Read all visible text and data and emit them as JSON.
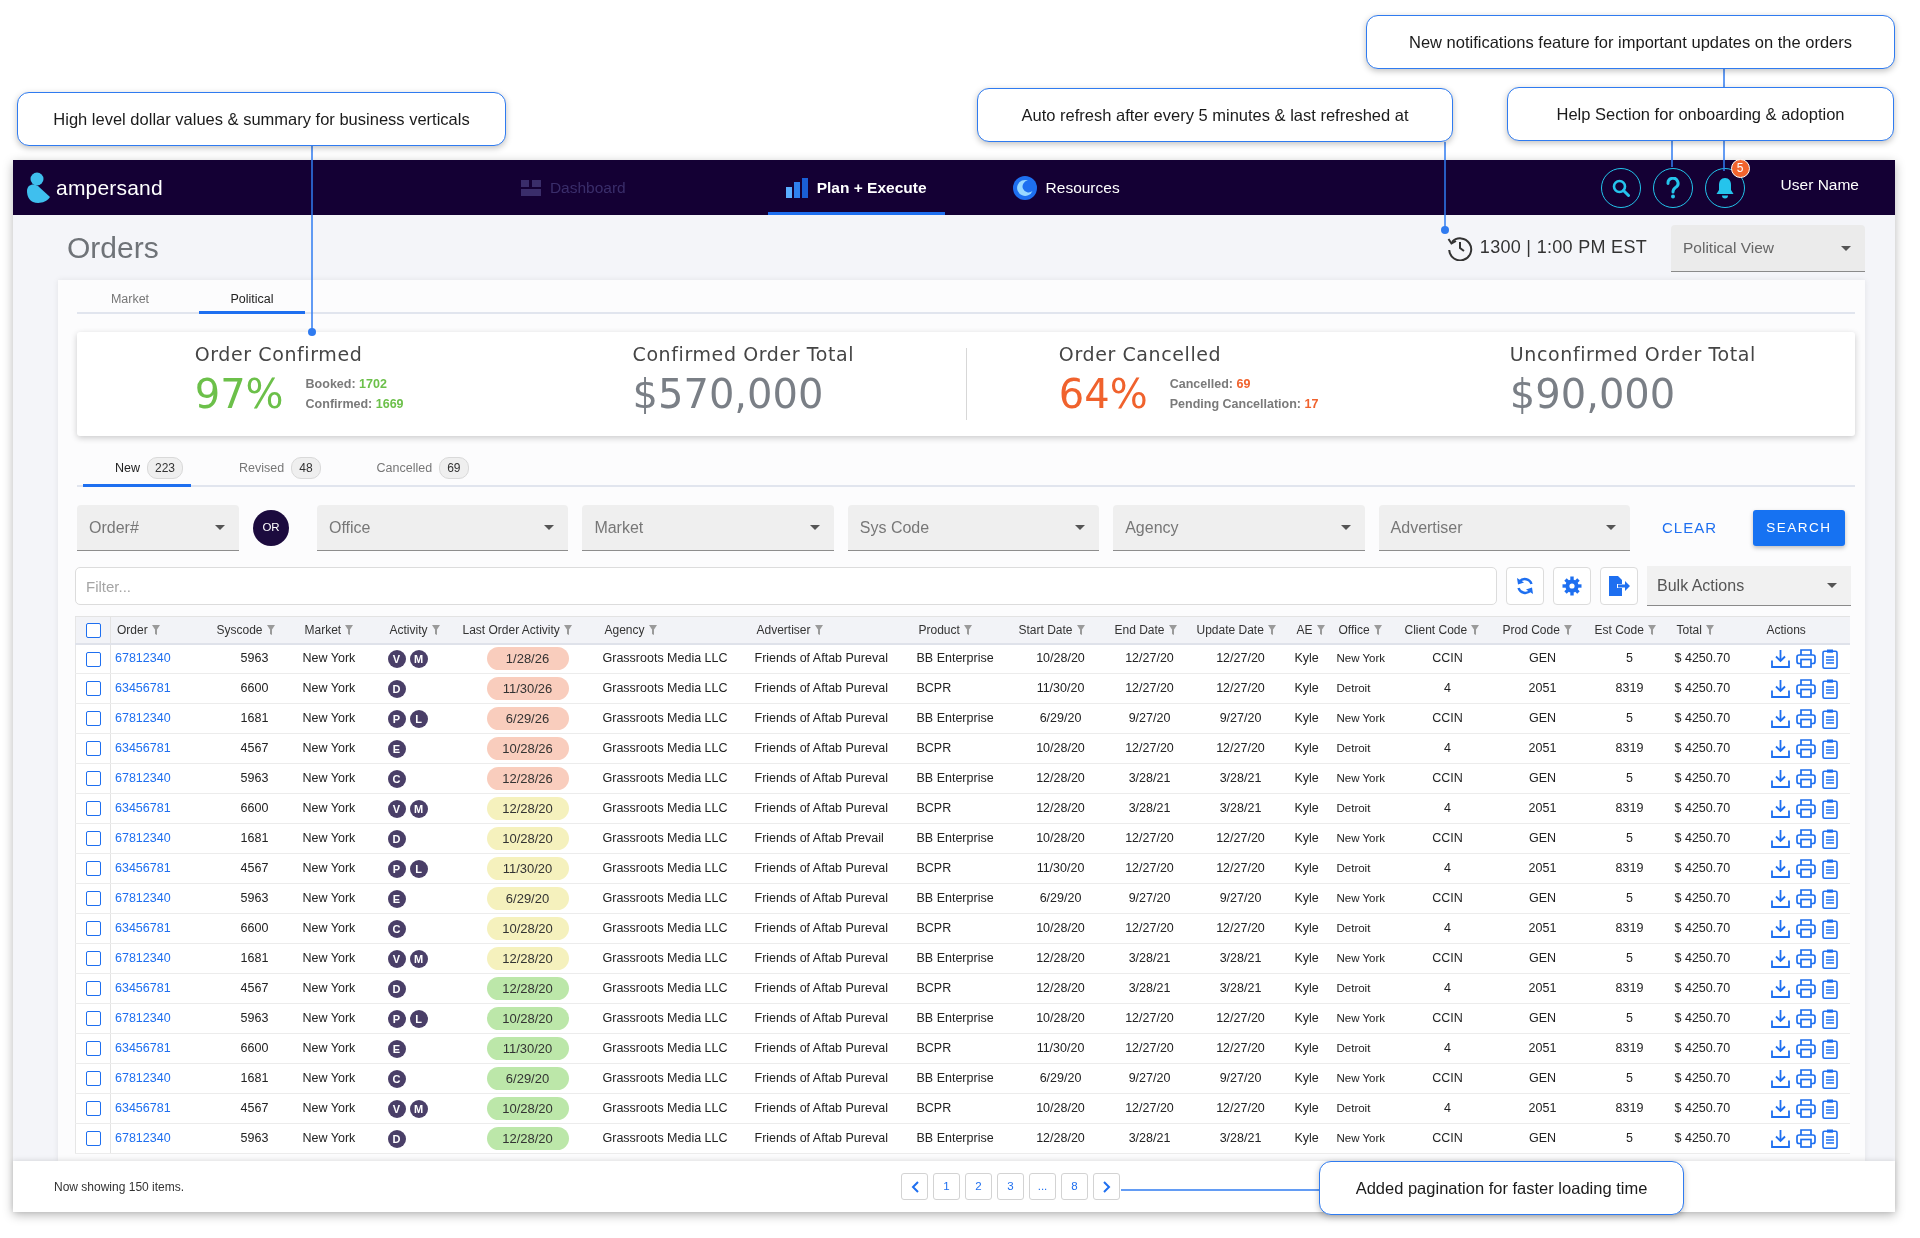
{
  "callouts": [
    {
      "text": "High level dollar values & summary for business verticals"
    },
    {
      "text": "Auto refresh after every 5 minutes & last refreshed at"
    },
    {
      "text": "New notifications feature for important updates on the orders"
    },
    {
      "text": "Help Section for onboarding & adoption"
    },
    {
      "text": "Added pagination for faster loading time"
    }
  ],
  "navbar": {
    "logo": "ampersand",
    "items": [
      {
        "label": "Dashboard",
        "selected": false,
        "disabled": true
      },
      {
        "label": "Plan + Execute",
        "selected": true,
        "disabled": false
      },
      {
        "label": "Resources",
        "selected": false,
        "disabled": false
      }
    ],
    "notification_count": "5",
    "user_name": "User Name"
  },
  "header": {
    "title": "Orders",
    "last_refreshed": "1300 | 1:00 PM EST",
    "view_select": {
      "value": "Political View"
    }
  },
  "view_tabs": [
    {
      "label": "Market",
      "selected": false
    },
    {
      "label": "Political",
      "selected": true
    }
  ],
  "summary": [
    {
      "kind": "percent",
      "title": "Order Confirmed",
      "value": "97%",
      "color": "#6cc04a",
      "details": [
        {
          "label": "Booked:",
          "value": "1702"
        },
        {
          "label": "Confirmed:",
          "value": "1669"
        }
      ]
    },
    {
      "kind": "total",
      "title": "Confirmed Order Total",
      "value": "$570,000"
    },
    {
      "kind": "percent",
      "title": "Order Cancelled",
      "value": "64%",
      "color": "#f0622d",
      "details": [
        {
          "label": "Cancelled:",
          "value": "69"
        },
        {
          "label": "Pending Cancellation:",
          "value": "17"
        }
      ]
    },
    {
      "kind": "total",
      "title": "Unconfirmed Order Total",
      "value": "$90,000"
    }
  ],
  "order_tabs": [
    {
      "label": "New",
      "count": "223",
      "selected": true
    },
    {
      "label": "Revised",
      "count": "48",
      "selected": false
    },
    {
      "label": "Cancelled",
      "count": "69",
      "selected": false
    }
  ],
  "filters": [
    {
      "kind": "select",
      "placeholder": "Order#"
    },
    {
      "kind": "or",
      "label": "OR"
    },
    {
      "kind": "select",
      "placeholder": "Office"
    },
    {
      "kind": "select",
      "placeholder": "Market"
    },
    {
      "kind": "select",
      "placeholder": "Sys Code"
    },
    {
      "kind": "select",
      "placeholder": "Agency"
    },
    {
      "kind": "select",
      "placeholder": "Advertiser"
    },
    {
      "kind": "link",
      "label": "CLEAR"
    },
    {
      "kind": "button",
      "label": "SEARCH"
    }
  ],
  "toolbar": {
    "filter": {
      "placeholder": "Filter..."
    },
    "bulk_actions": {
      "placeholder": "Bulk Actions"
    }
  },
  "table": {
    "select_all_checked": false,
    "columns": [
      {
        "label": "Order",
        "filter": true
      },
      {
        "label": "Syscode",
        "filter": true
      },
      {
        "label": "Market",
        "filter": true
      },
      {
        "label": "Activity",
        "filter": true
      },
      {
        "label": "Last Order Activity",
        "filter": true
      },
      {
        "label": "Agency",
        "filter": true
      },
      {
        "label": "Advertiser",
        "filter": true
      },
      {
        "label": "Product",
        "filter": true
      },
      {
        "label": "Start Date",
        "filter": true
      },
      {
        "label": "End Date",
        "filter": true
      },
      {
        "label": "Update Date",
        "filter": true
      },
      {
        "label": "AE",
        "filter": true
      },
      {
        "label": "Office",
        "filter": true
      },
      {
        "label": "Client Code",
        "filter": true
      },
      {
        "label": "Prod Code",
        "filter": true
      },
      {
        "label": "Est Code",
        "filter": true
      },
      {
        "label": "Total",
        "filter": true
      },
      {
        "label": "Actions",
        "filter": false
      }
    ],
    "rows": [
      {
        "checked": false,
        "order": "67812340",
        "syscode": "5963",
        "market": "New York",
        "activity": [
          "V",
          "M"
        ],
        "last_order_activity": {
          "date": "1/28/26",
          "color": "#f9cdbd"
        },
        "agency": "Grassroots Media LLC",
        "advertiser": "Friends of Aftab Pureval",
        "product": "BB Enterprise",
        "start_date": "10/28/20",
        "end_date": "12/27/20",
        "update_date": "12/27/20",
        "ae": "Kyle",
        "office": "New York",
        "client_code": "CCIN",
        "prod_code": "GEN",
        "est_code": "5",
        "total": "$ 4250.70"
      },
      {
        "checked": false,
        "order": "63456781",
        "syscode": "6600",
        "market": "New York",
        "activity": [
          "D"
        ],
        "last_order_activity": {
          "date": "11/30/26",
          "color": "#f9cdbd"
        },
        "agency": "Grassroots Media LLC",
        "advertiser": "Friends of Aftab Pureval",
        "product": "BCPR",
        "start_date": "11/30/20",
        "end_date": "12/27/20",
        "update_date": "12/27/20",
        "ae": "Kyle",
        "office": "Detroit",
        "client_code": "4",
        "prod_code": "2051",
        "est_code": "8319",
        "total": "$ 4250.70"
      },
      {
        "checked": false,
        "order": "67812340",
        "syscode": "1681",
        "market": "New York",
        "activity": [
          "P",
          "L"
        ],
        "last_order_activity": {
          "date": "6/29/26",
          "color": "#f9cdbd"
        },
        "agency": "Grassroots Media LLC",
        "advertiser": "Friends of Aftab Pureval",
        "product": "BB Enterprise",
        "start_date": "6/29/20",
        "end_date": "9/27/20",
        "update_date": "9/27/20",
        "ae": "Kyle",
        "office": "New York",
        "client_code": "CCIN",
        "prod_code": "GEN",
        "est_code": "5",
        "total": "$ 4250.70"
      },
      {
        "checked": false,
        "order": "63456781",
        "syscode": "4567",
        "market": "New York",
        "activity": [
          "E"
        ],
        "last_order_activity": {
          "date": "10/28/26",
          "color": "#f9cdbd"
        },
        "agency": "Grassroots Media LLC",
        "advertiser": "Friends of Aftab Pureval",
        "product": "BCPR",
        "start_date": "10/28/20",
        "end_date": "12/27/20",
        "update_date": "12/27/20",
        "ae": "Kyle",
        "office": "Detroit",
        "client_code": "4",
        "prod_code": "2051",
        "est_code": "8319",
        "total": "$ 4250.70"
      },
      {
        "checked": false,
        "order": "67812340",
        "syscode": "5963",
        "market": "New York",
        "activity": [
          "C"
        ],
        "last_order_activity": {
          "date": "12/28/26",
          "color": "#f9cdbd"
        },
        "agency": "Grassroots Media LLC",
        "advertiser": "Friends of Aftab Pureval",
        "product": "BB Enterprise",
        "start_date": "12/28/20",
        "end_date": "3/28/21",
        "update_date": "3/28/21",
        "ae": "Kyle",
        "office": "New York",
        "client_code": "CCIN",
        "prod_code": "GEN",
        "est_code": "5",
        "total": "$ 4250.70"
      },
      {
        "checked": false,
        "order": "63456781",
        "syscode": "6600",
        "market": "New York",
        "activity": [
          "V",
          "M"
        ],
        "last_order_activity": {
          "date": "12/28/20",
          "color": "#f5f1bd"
        },
        "agency": "Grassroots Media LLC",
        "advertiser": "Friends of Aftab Pureval",
        "product": "BCPR",
        "start_date": "12/28/20",
        "end_date": "3/28/21",
        "update_date": "3/28/21",
        "ae": "Kyle",
        "office": "Detroit",
        "client_code": "4",
        "prod_code": "2051",
        "est_code": "8319",
        "total": "$ 4250.70"
      },
      {
        "checked": false,
        "order": "67812340",
        "syscode": "1681",
        "market": "New York",
        "activity": [
          "D"
        ],
        "last_order_activity": {
          "date": "10/28/20",
          "color": "#f5f1bd"
        },
        "agency": "Grassroots Media LLC",
        "advertiser": "Friends of Aftab Prevail",
        "product": "BB Enterprise",
        "start_date": "10/28/20",
        "end_date": "12/27/20",
        "update_date": "12/27/20",
        "ae": "Kyle",
        "office": "New York",
        "client_code": "CCIN",
        "prod_code": "GEN",
        "est_code": "5",
        "total": "$ 4250.70"
      },
      {
        "checked": false,
        "order": "63456781",
        "syscode": "4567",
        "market": "New York",
        "activity": [
          "P",
          "L"
        ],
        "last_order_activity": {
          "date": "11/30/20",
          "color": "#f5f1bd"
        },
        "agency": "Grassroots Media LLC",
        "advertiser": "Friends of Aftab Pureval",
        "product": "BCPR",
        "start_date": "11/30/20",
        "end_date": "12/27/20",
        "update_date": "12/27/20",
        "ae": "Kyle",
        "office": "Detroit",
        "client_code": "4",
        "prod_code": "2051",
        "est_code": "8319",
        "total": "$ 4250.70"
      },
      {
        "checked": false,
        "order": "67812340",
        "syscode": "5963",
        "market": "New York",
        "activity": [
          "E"
        ],
        "last_order_activity": {
          "date": "6/29/20",
          "color": "#f5f1bd"
        },
        "agency": "Grassroots Media LLC",
        "advertiser": "Friends of Aftab Pureval",
        "product": "BB Enterprise",
        "start_date": "6/29/20",
        "end_date": "9/27/20",
        "update_date": "9/27/20",
        "ae": "Kyle",
        "office": "New York",
        "client_code": "CCIN",
        "prod_code": "GEN",
        "est_code": "5",
        "total": "$ 4250.70"
      },
      {
        "checked": false,
        "order": "63456781",
        "syscode": "6600",
        "market": "New York",
        "activity": [
          "C"
        ],
        "last_order_activity": {
          "date": "10/28/20",
          "color": "#f5f1bd"
        },
        "agency": "Grassroots Media LLC",
        "advertiser": "Friends of Aftab Pureval",
        "product": "BCPR",
        "start_date": "10/28/20",
        "end_date": "12/27/20",
        "update_date": "12/27/20",
        "ae": "Kyle",
        "office": "Detroit",
        "client_code": "4",
        "prod_code": "2051",
        "est_code": "8319",
        "total": "$ 4250.70"
      },
      {
        "checked": false,
        "order": "67812340",
        "syscode": "1681",
        "market": "New York",
        "activity": [
          "V",
          "M"
        ],
        "last_order_activity": {
          "date": "12/28/20",
          "color": "#f5f1bd"
        },
        "agency": "Grassroots Media LLC",
        "advertiser": "Friends of Aftab Pureval",
        "product": "BB Enterprise",
        "start_date": "12/28/20",
        "end_date": "3/28/21",
        "update_date": "3/28/21",
        "ae": "Kyle",
        "office": "New York",
        "client_code": "CCIN",
        "prod_code": "GEN",
        "est_code": "5",
        "total": "$ 4250.70"
      },
      {
        "checked": false,
        "order": "63456781",
        "syscode": "4567",
        "market": "New York",
        "activity": [
          "D"
        ],
        "last_order_activity": {
          "date": "12/28/20",
          "color": "#bce7a9"
        },
        "agency": "Grassroots Media LLC",
        "advertiser": "Friends of Aftab Pureval",
        "product": "BCPR",
        "start_date": "12/28/20",
        "end_date": "3/28/21",
        "update_date": "3/28/21",
        "ae": "Kyle",
        "office": "Detroit",
        "client_code": "4",
        "prod_code": "2051",
        "est_code": "8319",
        "total": "$ 4250.70"
      },
      {
        "checked": false,
        "order": "67812340",
        "syscode": "5963",
        "market": "New York",
        "activity": [
          "P",
          "L"
        ],
        "last_order_activity": {
          "date": "10/28/20",
          "color": "#bce7a9"
        },
        "agency": "Grassroots Media LLC",
        "advertiser": "Friends of Aftab Pureval",
        "product": "BB Enterprise",
        "start_date": "10/28/20",
        "end_date": "12/27/20",
        "update_date": "12/27/20",
        "ae": "Kyle",
        "office": "New York",
        "client_code": "CCIN",
        "prod_code": "GEN",
        "est_code": "5",
        "total": "$ 4250.70"
      },
      {
        "checked": false,
        "order": "63456781",
        "syscode": "6600",
        "market": "New York",
        "activity": [
          "E"
        ],
        "last_order_activity": {
          "date": "11/30/20",
          "color": "#bce7a9"
        },
        "agency": "Grassroots Media LLC",
        "advertiser": "Friends of Aftab Pureval",
        "product": "BCPR",
        "start_date": "11/30/20",
        "end_date": "12/27/20",
        "update_date": "12/27/20",
        "ae": "Kyle",
        "office": "Detroit",
        "client_code": "4",
        "prod_code": "2051",
        "est_code": "8319",
        "total": "$ 4250.70"
      },
      {
        "checked": false,
        "order": "67812340",
        "syscode": "1681",
        "market": "New York",
        "activity": [
          "C"
        ],
        "last_order_activity": {
          "date": "6/29/20",
          "color": "#bce7a9"
        },
        "agency": "Grassroots Media LLC",
        "advertiser": "Friends of Aftab Pureval",
        "product": "BB Enterprise",
        "start_date": "6/29/20",
        "end_date": "9/27/20",
        "update_date": "9/27/20",
        "ae": "Kyle",
        "office": "New York",
        "client_code": "CCIN",
        "prod_code": "GEN",
        "est_code": "5",
        "total": "$ 4250.70"
      },
      {
        "checked": false,
        "order": "63456781",
        "syscode": "4567",
        "market": "New York",
        "activity": [
          "V",
          "M"
        ],
        "last_order_activity": {
          "date": "10/28/20",
          "color": "#bce7a9"
        },
        "agency": "Grassroots Media LLC",
        "advertiser": "Friends of Aftab Pureval",
        "product": "BCPR",
        "start_date": "10/28/20",
        "end_date": "12/27/20",
        "update_date": "12/27/20",
        "ae": "Kyle",
        "office": "Detroit",
        "client_code": "4",
        "prod_code": "2051",
        "est_code": "8319",
        "total": "$ 4250.70"
      },
      {
        "checked": false,
        "order": "67812340",
        "syscode": "5963",
        "market": "New York",
        "activity": [
          "D"
        ],
        "last_order_activity": {
          "date": "12/28/20",
          "color": "#bce7a9"
        },
        "agency": "Grassroots Media LLC",
        "advertiser": "Friends of Aftab Pureval",
        "product": "BB Enterprise",
        "start_date": "12/28/20",
        "end_date": "3/28/21",
        "update_date": "3/28/21",
        "ae": "Kyle",
        "office": "New York",
        "client_code": "CCIN",
        "prod_code": "GEN",
        "est_code": "5",
        "total": "$ 4250.70"
      }
    ]
  },
  "footer": {
    "item_count": "Now showing 150 items.",
    "pages": [
      "1",
      "2",
      "3",
      "...",
      "8"
    ]
  }
}
